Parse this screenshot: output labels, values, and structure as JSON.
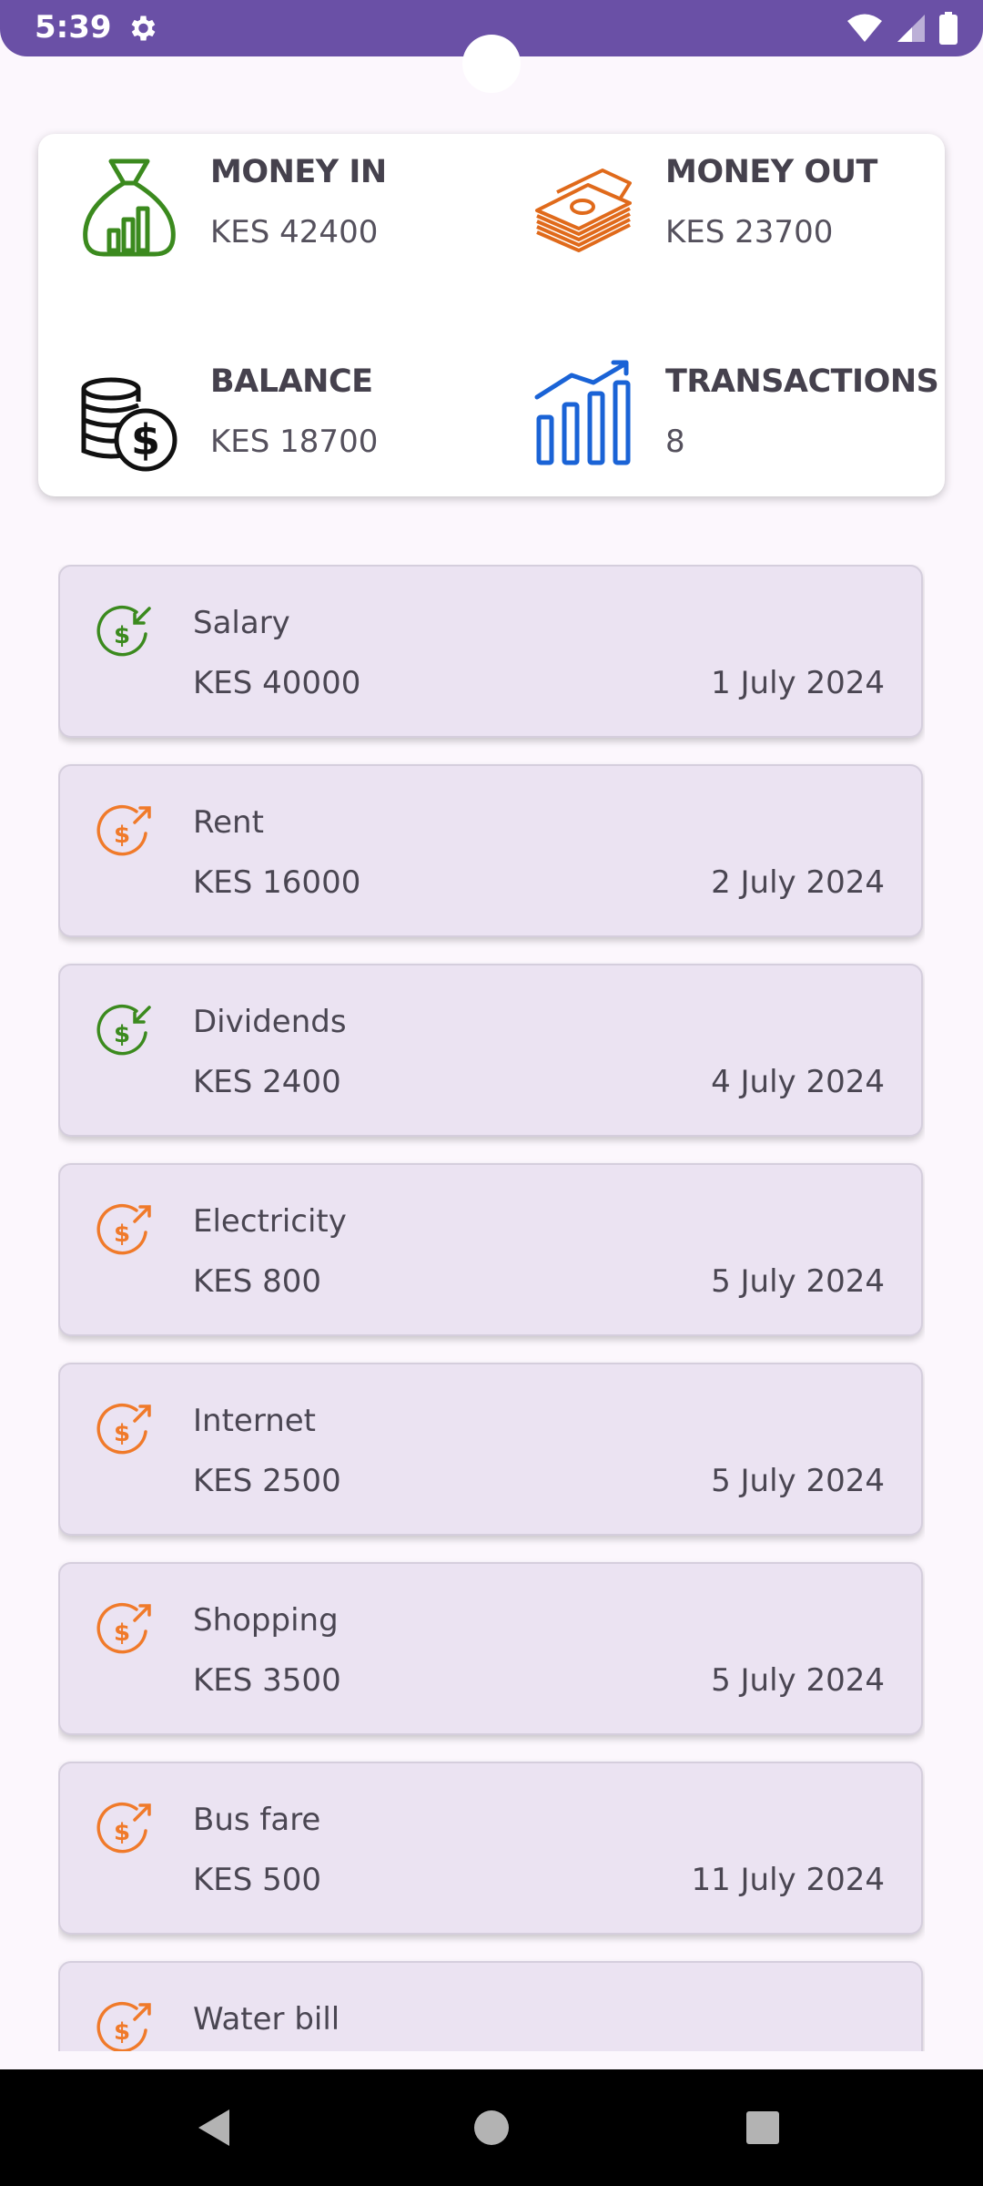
{
  "status_bar": {
    "time": "5:39"
  },
  "summary": {
    "money_in": {
      "title": "MONEY IN",
      "value": "KES 42400",
      "icon": "money-bag-icon",
      "color": "#3b8a1e"
    },
    "money_out": {
      "title": "MONEY OUT",
      "value": "KES 23700",
      "icon": "cash-stack-icon",
      "color": "#e06a1b"
    },
    "balance": {
      "title": "BALANCE",
      "value": "KES 18700",
      "icon": "coins-icon",
      "color": "#111111"
    },
    "transactions": {
      "title": "TRANSACTIONS",
      "value": "8",
      "icon": "bar-chart-icon",
      "color": "#1a63d6"
    }
  },
  "transactions": [
    {
      "name": "Salary",
      "amount": "KES 40000",
      "date": "1 July 2024",
      "type": "in"
    },
    {
      "name": "Rent",
      "amount": "KES 16000",
      "date": "2 July 2024",
      "type": "out"
    },
    {
      "name": "Dividends",
      "amount": "KES 2400",
      "date": "4 July 2024",
      "type": "in"
    },
    {
      "name": "Electricity",
      "amount": "KES 800",
      "date": "5 July 2024",
      "type": "out"
    },
    {
      "name": "Internet",
      "amount": "KES 2500",
      "date": "5 July 2024",
      "type": "out"
    },
    {
      "name": "Shopping",
      "amount": "KES 3500",
      "date": "5 July 2024",
      "type": "out"
    },
    {
      "name": "Bus fare",
      "amount": "KES 500",
      "date": "11 July 2024",
      "type": "out"
    },
    {
      "name": "Water bill",
      "amount": "",
      "date": "",
      "type": "out"
    }
  ],
  "colors": {
    "accent": "#6a50a6",
    "in": "#3b8a1e",
    "out": "#f07a2a",
    "card": "#ebe3f2"
  }
}
